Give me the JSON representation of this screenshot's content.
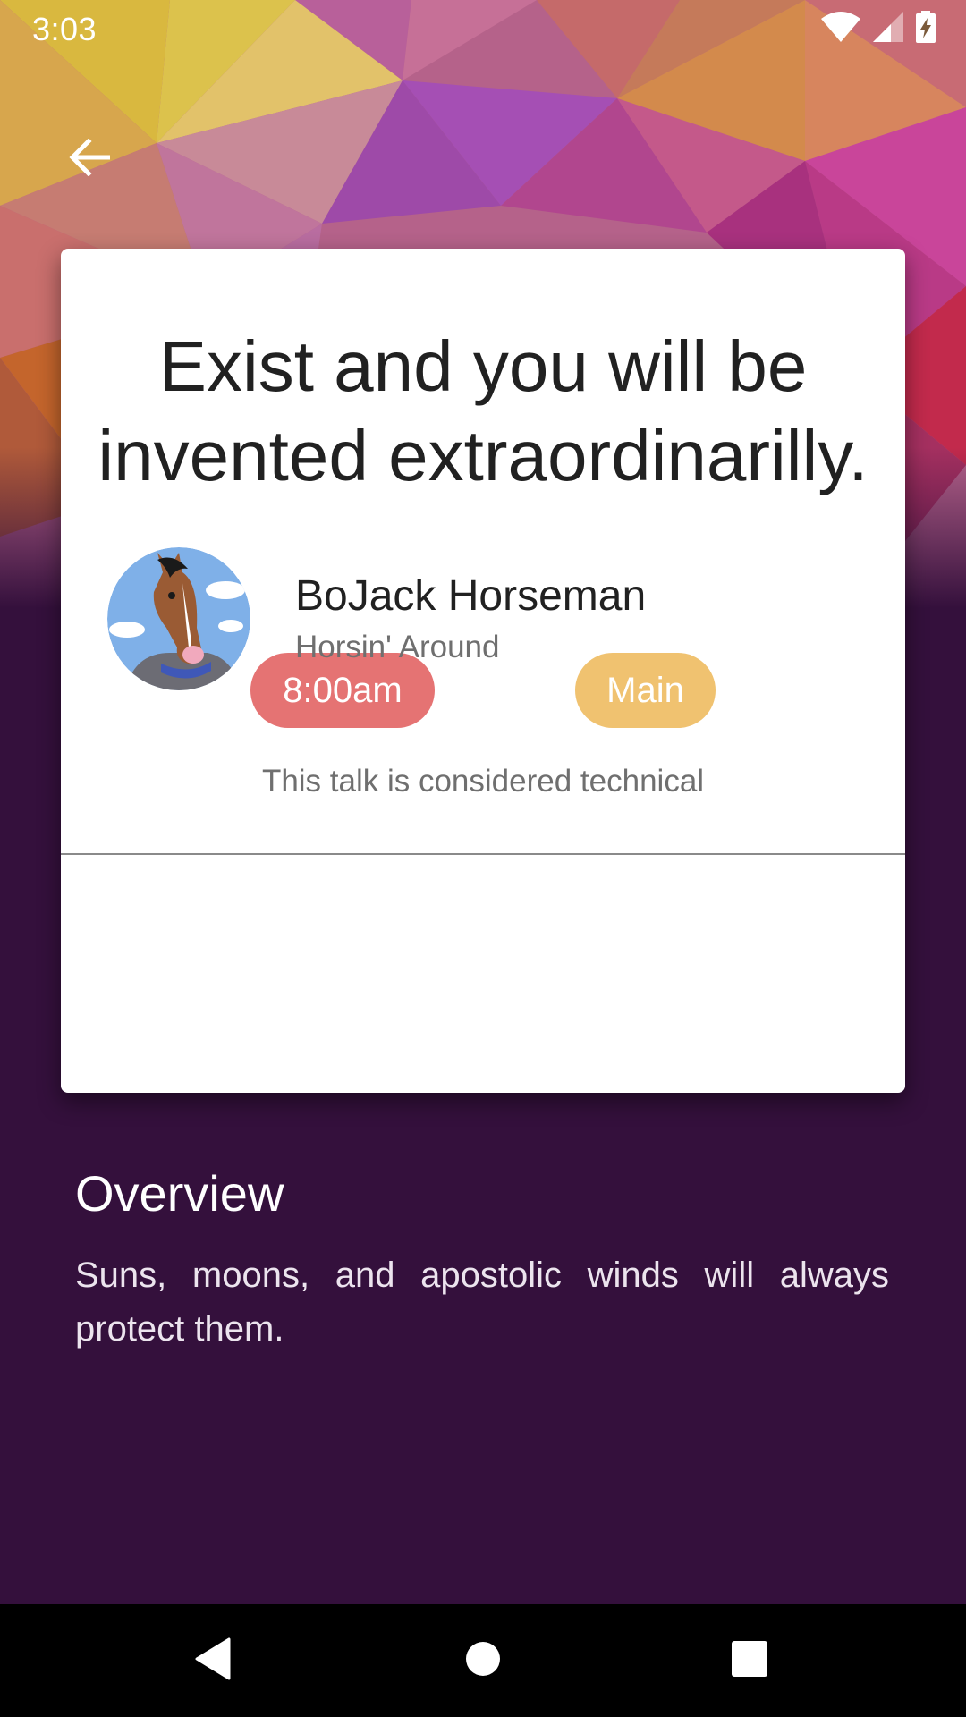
{
  "status_bar": {
    "time": "3:03",
    "icons": [
      "wifi-icon",
      "cellular-signal-icon",
      "battery-charging-icon"
    ]
  },
  "header": {
    "back_icon": "arrow-back-icon"
  },
  "session": {
    "title": "Exist and you will be invented extraordinarilly.",
    "time_chip": "8:00am",
    "track_chip": "Main",
    "technical_note": "This talk is considered technical",
    "colors": {
      "time_chip": "#e57373",
      "track_chip": "#f0c270"
    }
  },
  "speaker": {
    "name": "BoJack Horseman",
    "company": "Horsin' Around",
    "avatar_icon": "speaker-avatar"
  },
  "overview": {
    "heading": "Overview",
    "description": "Suns, moons, and apostolic winds will always protect them."
  },
  "nav_bar": {
    "icons": [
      "nav-back-icon",
      "nav-home-icon",
      "nav-recents-icon"
    ]
  },
  "colors": {
    "background": "#34103c",
    "card": "#ffffff"
  }
}
